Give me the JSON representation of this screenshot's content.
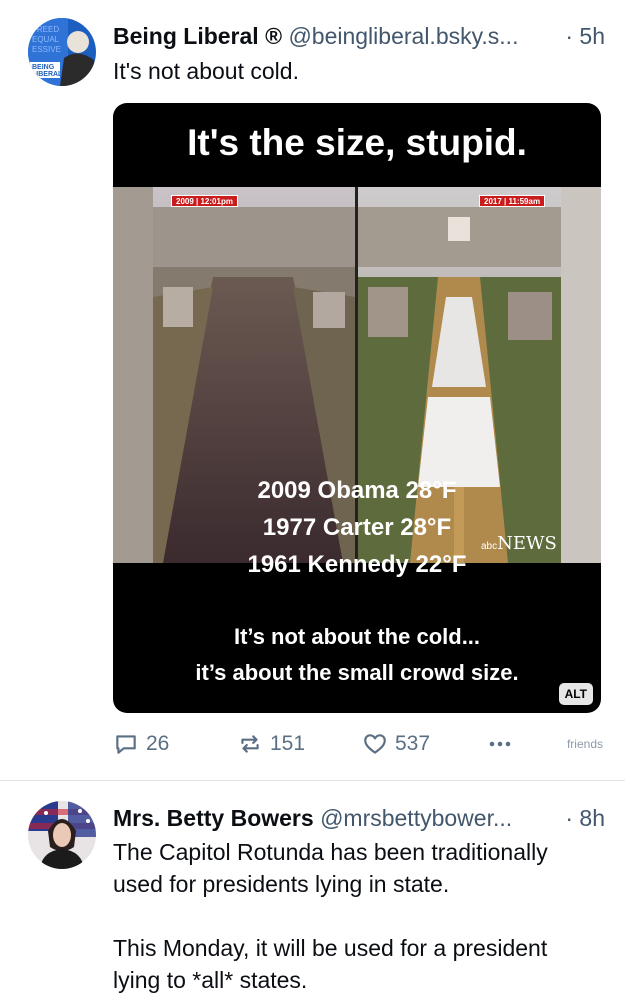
{
  "posts": [
    {
      "author_name": "Being Liberal",
      "verified_mark": "®",
      "handle": "@beingliberal.bsky.s...",
      "time": "· 5h",
      "text": "It's not about cold.",
      "avatar_icon": "being-liberal-avatar",
      "embed": {
        "title": "It's the size, stupid.",
        "stamp_left": "2009 | 12:01pm",
        "stamp_right": "2017 | 11:59am",
        "logo_small": "abc",
        "logo_text": "NEWS",
        "stats": [
          "2009 Obama 28°F",
          "1977 Carter 28°F",
          "1961 Kennedy 22°F"
        ],
        "caption_lines": [
          "It’s not about the cold...",
          "it’s about the small crowd size."
        ],
        "alt_label": "ALT"
      },
      "actions": {
        "replies": "26",
        "reposts": "151",
        "likes": "537",
        "label": "friends"
      }
    },
    {
      "author_name": "Mrs. Betty Bowers",
      "handle": "@mrsbettybower...",
      "time": "· 8h",
      "text_lines": [
        "The Capitol Rotunda has been traditionally",
        "used for presidents lying in state.",
        "",
        "This Monday, it will be used for a president",
        "lying to *all* states."
      ],
      "avatar_icon": "betty-bowers-avatar"
    }
  ],
  "colors": {
    "text": "#0b0f14",
    "secondary": "#42576c",
    "action": "#5b6f84",
    "divider": "#dfe3e8",
    "stamp_red": "#c91d1d"
  }
}
